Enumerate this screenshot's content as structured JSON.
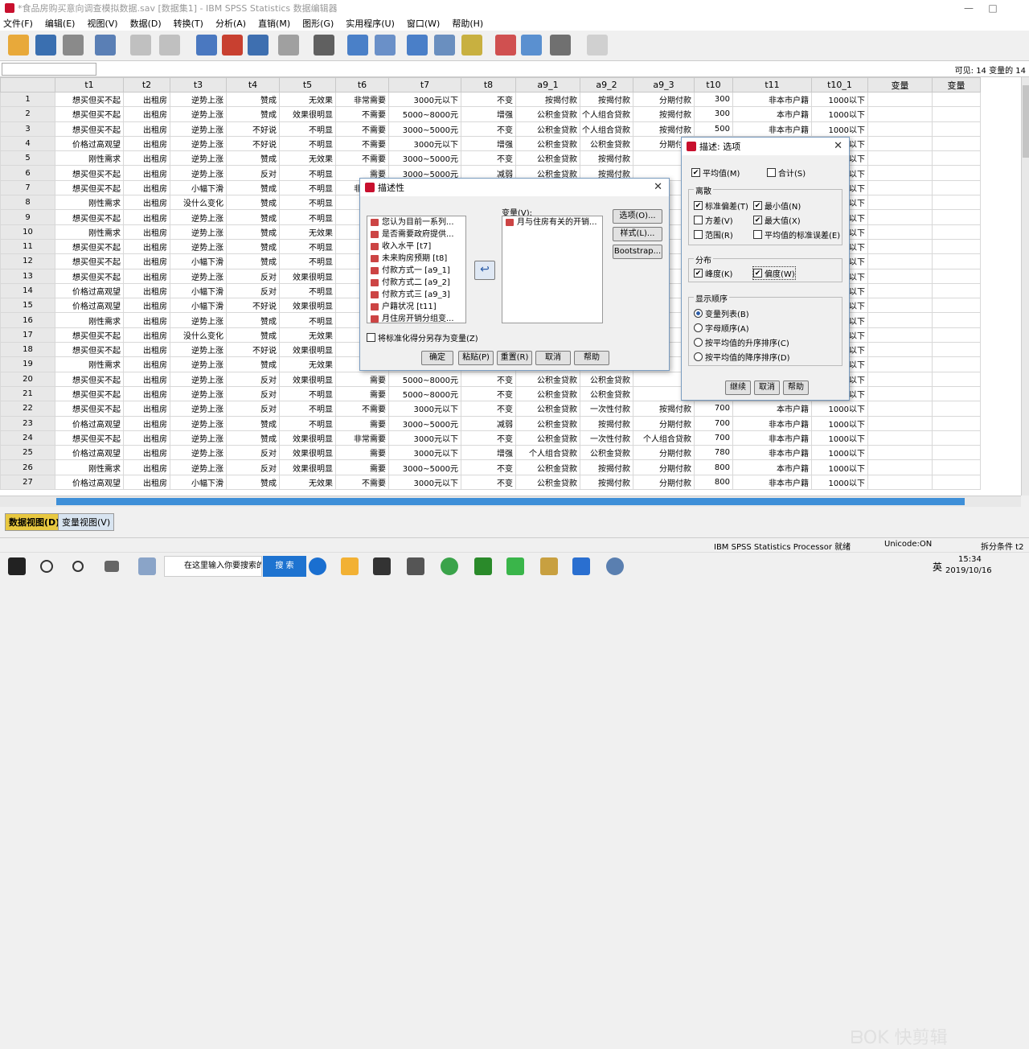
{
  "window": {
    "title": "*食品房购买意向调查模拟数据.sav [数据集1] - IBM SPSS Statistics 数据编辑器",
    "min_glyph": "—",
    "max_glyph": "□"
  },
  "menu": [
    "文件(F)",
    "编辑(E)",
    "视图(V)",
    "数据(D)",
    "转换(T)",
    "分析(A)",
    "直销(M)",
    "图形(G)",
    "实用程序(U)",
    "窗口(W)",
    "帮助(H)"
  ],
  "visible_label": "可见: 14 变量的 14",
  "columns": [
    "t1",
    "t2",
    "t3",
    "t4",
    "t5",
    "t6",
    "t7",
    "t8",
    "a9_1",
    "a9_2",
    "a9_3",
    "t10",
    "t11",
    "t10_1",
    "变量",
    "变量"
  ],
  "rows": [
    [
      "想买但买不起",
      "出租房",
      "逆势上涨",
      "赞成",
      "无效果",
      "非常需要",
      "3000元以下",
      "不变",
      "按揭付款",
      "按揭付款",
      "分期付款",
      "300",
      "非本市户籍",
      "1000以下"
    ],
    [
      "想买但买不起",
      "出租房",
      "逆势上涨",
      "赞成",
      "效果很明显",
      "不需要",
      "5000~8000元",
      "增强",
      "公积金贷款",
      "个人组合贷款",
      "按揭付款",
      "300",
      "本市户籍",
      "1000以下"
    ],
    [
      "想买但买不起",
      "出租房",
      "逆势上涨",
      "不好说",
      "不明显",
      "不需要",
      "3000~5000元",
      "不变",
      "公积金贷款",
      "个人组合贷款",
      "按揭付款",
      "500",
      "非本市户籍",
      "1000以下"
    ],
    [
      "价格过高观望",
      "出租房",
      "逆势上涨",
      "不好说",
      "不明显",
      "不需要",
      "3000元以下",
      "增强",
      "公积金贷款",
      "公积金贷款",
      "分期付款",
      "",
      "",
      "1000以下"
    ],
    [
      "刚性需求",
      "出租房",
      "逆势上涨",
      "赞成",
      "无效果",
      "不需要",
      "3000~5000元",
      "不变",
      "公积金贷款",
      "按揭付款",
      "",
      "",
      "",
      "1000以下"
    ],
    [
      "想买但买不起",
      "出租房",
      "逆势上涨",
      "反对",
      "不明显",
      "需要",
      "3000~5000元",
      "减弱",
      "公积金贷款",
      "按揭付款",
      "",
      "",
      "",
      "1000以下"
    ],
    [
      "想买但买不起",
      "出租房",
      "小幅下滑",
      "赞成",
      "不明显",
      "非常需要",
      "",
      "",
      "",
      "",
      "",
      "",
      "",
      "1000以下"
    ],
    [
      "刚性需求",
      "出租房",
      "没什么变化",
      "赞成",
      "不明显",
      "",
      "",
      "",
      "",
      "",
      "",
      "",
      "",
      "1000以下"
    ],
    [
      "想买但买不起",
      "出租房",
      "逆势上涨",
      "赞成",
      "不明显",
      "",
      "",
      "",
      "",
      "",
      "",
      "",
      "",
      "1000以下"
    ],
    [
      "刚性需求",
      "出租房",
      "逆势上涨",
      "赞成",
      "无效果",
      "非",
      "",
      "",
      "",
      "",
      "",
      "",
      "",
      "1000以下"
    ],
    [
      "想买但买不起",
      "出租房",
      "逆势上涨",
      "赞成",
      "不明显",
      "",
      "",
      "",
      "",
      "",
      "",
      "",
      "",
      "1000以下"
    ],
    [
      "想买但买不起",
      "出租房",
      "小幅下滑",
      "赞成",
      "不明显",
      "",
      "",
      "",
      "",
      "",
      "",
      "",
      "",
      "1000以下"
    ],
    [
      "想买但买不起",
      "出租房",
      "逆势上涨",
      "反对",
      "效果很明显",
      "",
      "",
      "",
      "",
      "",
      "",
      "",
      "",
      "1000以下"
    ],
    [
      "价格过高观望",
      "出租房",
      "小幅下滑",
      "反对",
      "不明显",
      "",
      "",
      "",
      "",
      "",
      "",
      "",
      "",
      "1000以下"
    ],
    [
      "价格过高观望",
      "出租房",
      "小幅下滑",
      "不好说",
      "效果很明显",
      "",
      "",
      "",
      "",
      "",
      "",
      "",
      "",
      "1000以下"
    ],
    [
      "刚性需求",
      "出租房",
      "逆势上涨",
      "赞成",
      "不明显",
      "非",
      "",
      "",
      "",
      "",
      "",
      "",
      "",
      "1000以下"
    ],
    [
      "想买但买不起",
      "出租房",
      "没什么变化",
      "赞成",
      "无效果",
      "非",
      "",
      "",
      "",
      "",
      "",
      "",
      "",
      "1000以下"
    ],
    [
      "想买但买不起",
      "出租房",
      "逆势上涨",
      "不好说",
      "效果很明显",
      "",
      "",
      "",
      "",
      "",
      "",
      "",
      "",
      "1000以下"
    ],
    [
      "刚性需求",
      "出租房",
      "逆势上涨",
      "赞成",
      "无效果",
      "非",
      "",
      "",
      "",
      "",
      "",
      "",
      "",
      "1000以下"
    ],
    [
      "想买但买不起",
      "出租房",
      "逆势上涨",
      "反对",
      "效果很明显",
      "需要",
      "5000~8000元",
      "不变",
      "公积金贷款",
      "公积金贷款",
      "",
      "",
      "",
      "1000以下"
    ],
    [
      "想买但买不起",
      "出租房",
      "逆势上涨",
      "反对",
      "不明显",
      "需要",
      "5000~8000元",
      "不变",
      "公积金贷款",
      "公积金贷款",
      "",
      "",
      "",
      "1000以下"
    ],
    [
      "想买但买不起",
      "出租房",
      "逆势上涨",
      "反对",
      "不明显",
      "不需要",
      "3000元以下",
      "不变",
      "公积金贷款",
      "一次性付款",
      "按揭付款",
      "700",
      "本市户籍",
      "1000以下"
    ],
    [
      "价格过高观望",
      "出租房",
      "逆势上涨",
      "赞成",
      "不明显",
      "需要",
      "3000~5000元",
      "减弱",
      "公积金贷款",
      "按揭付款",
      "分期付款",
      "700",
      "非本市户籍",
      "1000以下"
    ],
    [
      "想买但买不起",
      "出租房",
      "逆势上涨",
      "赞成",
      "效果很明显",
      "非常需要",
      "3000元以下",
      "不变",
      "公积金贷款",
      "一次性付款",
      "个人组合贷款",
      "700",
      "非本市户籍",
      "1000以下"
    ],
    [
      "价格过高观望",
      "出租房",
      "逆势上涨",
      "反对",
      "效果很明显",
      "需要",
      "3000元以下",
      "增强",
      "个人组合贷款",
      "公积金贷款",
      "分期付款",
      "780",
      "非本市户籍",
      "1000以下"
    ],
    [
      "刚性需求",
      "出租房",
      "逆势上涨",
      "反对",
      "效果很明显",
      "需要",
      "3000~5000元",
      "不变",
      "公积金贷款",
      "按揭付款",
      "分期付款",
      "800",
      "本市户籍",
      "1000以下"
    ],
    [
      "价格过高观望",
      "出租房",
      "小幅下滑",
      "赞成",
      "无效果",
      "不需要",
      "3000元以下",
      "不变",
      "公积金贷款",
      "按揭付款",
      "分期付款",
      "800",
      "非本市户籍",
      "1000以下"
    ]
  ],
  "tabs": {
    "data_view": "数据视图(D)",
    "variable_view": "变量视图(V)"
  },
  "status": {
    "processor": "IBM SPSS Statistics Processor 就绪",
    "unicode": "Unicode:ON",
    "split": "拆分条件 t2"
  },
  "watermark": "ᗷOK 快剪辑",
  "descriptives_dialog": {
    "title": "描述性",
    "source_vars": [
      "您认为目前一系列...",
      "是否需要政府提供...",
      "收入水平 [t7]",
      "未来购房预期 [t8]",
      "付款方式一 [a9_1]",
      "付款方式二 [a9_2]",
      "付款方式三 [a9_3]",
      "户籍状况 [t11]",
      "月住房开销分组变..."
    ],
    "target_label": "变量(V):",
    "target_vars": [
      "月与住房有关的开销..."
    ],
    "buttons": {
      "options": "选项(O)...",
      "style": "样式(L)...",
      "bootstrap": "Bootstrap...",
      "ok": "确定",
      "paste": "粘贴(P)",
      "reset": "重置(R)",
      "cancel": "取消",
      "help": "帮助"
    },
    "save_standardized": "将标准化得分另存为变量(Z)"
  },
  "options_dialog": {
    "title": "描述: 选项",
    "mean": "平均值(M)",
    "sum": "合计(S)",
    "dispersion_title": "离散",
    "stddev": "标准偏差(T)",
    "min": "最小值(N)",
    "variance": "方差(V)",
    "max": "最大值(X)",
    "range": "范围(R)",
    "se_mean": "平均值的标准误差(E)",
    "distribution_title": "分布",
    "kurtosis": "峰度(K)",
    "skewness": "偏度(W)",
    "order_title": "显示顺序",
    "order_variable_list": "变量列表(B)",
    "order_alpha": "字母顺序(A)",
    "order_asc": "按平均值的升序排序(C)",
    "order_desc": "按平均值的降序排序(D)",
    "buttons": {
      "continue": "继续",
      "cancel": "取消",
      "help": "帮助"
    }
  },
  "taskbar": {
    "search_placeholder": "在这里输入你要搜索的内容",
    "search_btn": "搜 索",
    "ime": "英",
    "time": "15:34",
    "date": "2019/10/16"
  }
}
